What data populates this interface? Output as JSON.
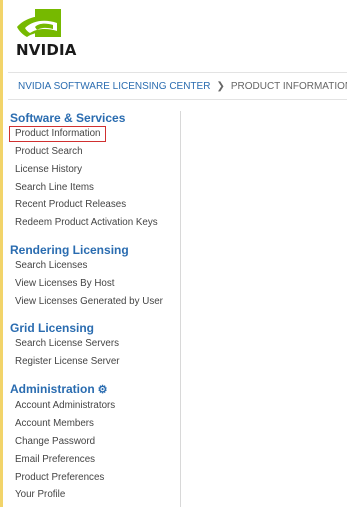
{
  "brand": {
    "logo_text": "NVIDIA",
    "accent": "#76b900"
  },
  "breadcrumb": {
    "root": "NVIDIA SOFTWARE LICENSING CENTER",
    "separator_icon": "chevron-right-icon",
    "current": "PRODUCT INFORMATION :"
  },
  "sidebar": {
    "sections": [
      {
        "title": "Software & Services",
        "items": [
          {
            "label": "Product Information",
            "selected": true
          },
          {
            "label": "Product Search"
          },
          {
            "label": "License History"
          },
          {
            "label": "Search Line Items"
          },
          {
            "label": "Recent Product Releases"
          },
          {
            "label": "Redeem Product Activation Keys"
          }
        ]
      },
      {
        "title": "Rendering Licensing",
        "items": [
          {
            "label": "Search Licenses"
          },
          {
            "label": "View Licenses By Host"
          },
          {
            "label": "View Licenses Generated by User"
          }
        ]
      },
      {
        "title": "Grid Licensing",
        "items": [
          {
            "label": "Search License Servers"
          },
          {
            "label": "Register License Server"
          }
        ]
      },
      {
        "title": "Administration",
        "title_icon": "gear-icon",
        "items": [
          {
            "label": "Account Administrators"
          },
          {
            "label": "Account Members"
          },
          {
            "label": "Change Password"
          },
          {
            "label": "Email Preferences"
          },
          {
            "label": "Product Preferences"
          },
          {
            "label": "Your Profile"
          }
        ]
      }
    ]
  },
  "colors": {
    "link": "#2a6cb0",
    "selection_border": "#d03030",
    "text": "#444444"
  }
}
